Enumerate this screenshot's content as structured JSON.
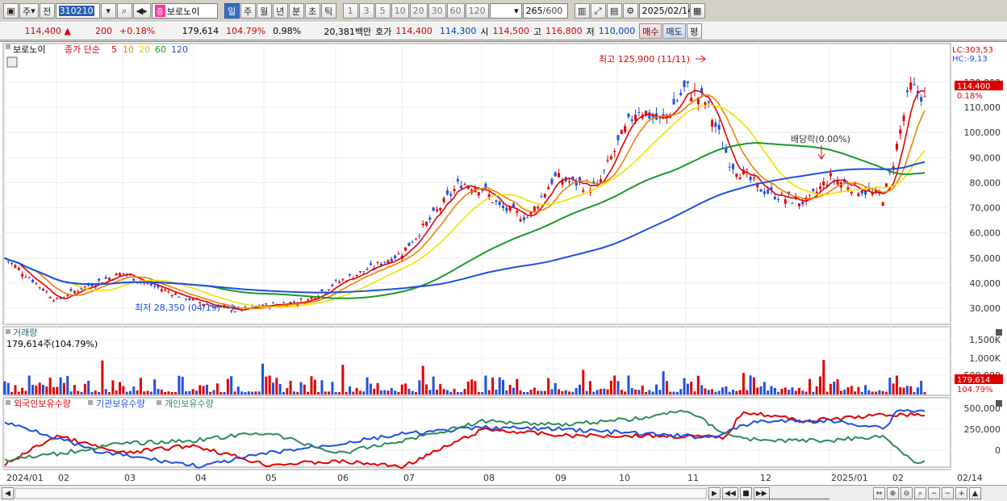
{
  "toolbar": {
    "period_type": "주",
    "prev_label": "전",
    "stock_code": "310210",
    "stock_name": "보로노이",
    "name_badge": "증",
    "periods": [
      "일",
      "주",
      "월",
      "년",
      "분",
      "초",
      "틱"
    ],
    "active_period": "일",
    "intervals": [
      "1",
      "3",
      "5",
      "10",
      "20",
      "30",
      "60",
      "120"
    ],
    "count": "265",
    "count_total": "/600",
    "date": "2025/02/14"
  },
  "quote": {
    "price": "114,400",
    "change_arrow": "▲",
    "change": "200",
    "change_pct": "+0.18%",
    "volume": "179,614",
    "volume_ratio": "104.79%",
    "turnover": "0.98%",
    "amount": "20,381백만",
    "ask_label": "호가",
    "ask": "114,400",
    "bid": "114,300",
    "open_label": "시",
    "open": "114,500",
    "high_label": "고",
    "high": "116,800",
    "low_label": "저",
    "low": "110,000",
    "buy_label": "매수",
    "sell_label": "매도",
    "eval_label": "평"
  },
  "price_panel": {
    "stock_label": "보로노이",
    "ma_label": "종가 단순",
    "ma_periods": [
      "5",
      "10",
      "20",
      "60",
      "120"
    ],
    "lc_label": "LC:303,53",
    "hc_label": "HC:-9,13",
    "high_annotation": "최고 125,900 (11/11)",
    "low_annotation": "최저 28,350 (04/19)",
    "dividend_annotation": "배당락(0.00%)",
    "last_price_tag": "114,400",
    "last_change_tag": "0.18%",
    "y_ticks": [
      "120,000",
      "110,000",
      "100,000",
      "90,000",
      "80,000",
      "70,000",
      "60,000",
      "50,000",
      "40,000",
      "30,000"
    ]
  },
  "volume_panel": {
    "title": "거래량",
    "value": "179,614주(104.79%)",
    "y_ticks": [
      "1,500K",
      "1,000K",
      "500,000"
    ],
    "last_tag": "179,614",
    "ratio_tag": "104.79%"
  },
  "holdings_panel": {
    "legend": [
      "외국인보유수량",
      "기관보유수량",
      "개인보유수량"
    ],
    "y_ticks": [
      "500,000",
      "250,000",
      "0"
    ]
  },
  "x_axis": [
    "2024/01",
    "02",
    "03",
    "04",
    "05",
    "06",
    "07",
    "08",
    "09",
    "10",
    "11",
    "12",
    "2025/01",
    "02"
  ],
  "x_end_label": "02/14",
  "chart_data": {
    "type": "candlestick",
    "title": "보로노이",
    "x": [
      "2024/01",
      "2024/02",
      "2024/03",
      "2024/04",
      "2024/05",
      "2024/06",
      "2024/07",
      "2024/08",
      "2024/09",
      "2024/10",
      "2024/11",
      "2024/12",
      "2025/01",
      "2025/02/14"
    ],
    "close_approx": [
      48000,
      36000,
      43000,
      30000,
      31000,
      40000,
      52000,
      75000,
      78000,
      92000,
      112000,
      75000,
      78000,
      114400
    ],
    "ylim": [
      25000,
      125000
    ],
    "series": [
      {
        "name": "MA5",
        "color": "#e00000"
      },
      {
        "name": "MA10",
        "color": "#f08000"
      },
      {
        "name": "MA20",
        "color": "#f0e000"
      },
      {
        "name": "MA60",
        "color": "#1a9a2a"
      },
      {
        "name": "MA120",
        "color": "#1f4fe0"
      }
    ]
  },
  "colors": {
    "up": "#e00000",
    "down": "#1f4fe0",
    "ma5": "#e00000",
    "ma10": "#f08000",
    "ma20": "#f0e000",
    "ma60": "#1a9a2a",
    "ma120": "#1f4fe0",
    "foreign": "#e00000",
    "inst": "#1f4fe0",
    "retail": "#2e8b57"
  }
}
